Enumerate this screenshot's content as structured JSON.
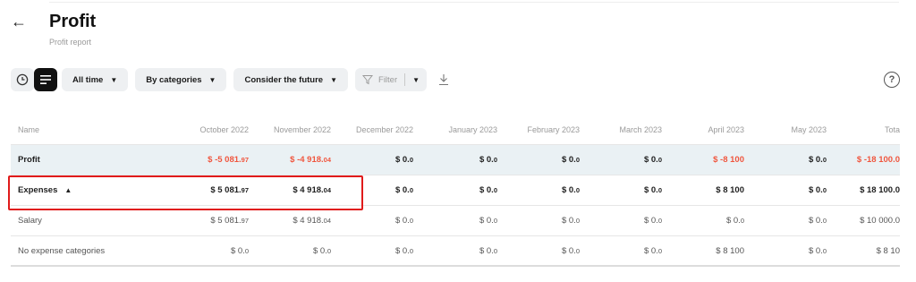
{
  "header": {
    "back_icon": "arrow-left-icon",
    "title": "Profit",
    "subtitle": "Profit report"
  },
  "toolbar": {
    "clock_icon": "clock-icon",
    "list_icon": "list-icon",
    "period": "All time",
    "grouping": "By categories",
    "future": "Consider the future",
    "filter_placeholder": "Filter",
    "download_icon": "download-icon",
    "help_icon": "help-icon"
  },
  "table": {
    "columns": [
      "Name",
      "October 2022",
      "November 2022",
      "December 2022",
      "January 2023",
      "February 2023",
      "March 2023",
      "April 2023",
      "May 2023",
      "Tota"
    ],
    "rows": [
      {
        "name": "Profit",
        "cells": [
          {
            "main": "$ -5 081.",
            "cents": "97",
            "tone": "neg"
          },
          {
            "main": "$ -4 918.",
            "cents": "04",
            "tone": "neg"
          },
          {
            "main": "$ 0.",
            "cents": "0",
            "tone": "pos"
          },
          {
            "main": "$ 0.",
            "cents": "0",
            "tone": "pos"
          },
          {
            "main": "$ 0.",
            "cents": "0",
            "tone": "pos"
          },
          {
            "main": "$ 0.",
            "cents": "0",
            "tone": "pos"
          },
          {
            "main": "$ -8 100",
            "cents": "",
            "tone": "neg"
          },
          {
            "main": "$ 0.",
            "cents": "0",
            "tone": "pos"
          },
          {
            "main": "$ -18 100.0",
            "cents": "",
            "tone": "neg"
          }
        ]
      },
      {
        "name": "Expenses",
        "cells": [
          {
            "main": "$ 5 081.",
            "cents": "97"
          },
          {
            "main": "$ 4 918.",
            "cents": "04"
          },
          {
            "main": "$ 0.",
            "cents": "0"
          },
          {
            "main": "$ 0.",
            "cents": "0"
          },
          {
            "main": "$ 0.",
            "cents": "0"
          },
          {
            "main": "$ 0.",
            "cents": "0"
          },
          {
            "main": "$ 8 100",
            "cents": ""
          },
          {
            "main": "$ 0.",
            "cents": "0"
          },
          {
            "main": "$ 18 100.0",
            "cents": ""
          }
        ]
      },
      {
        "name": "Salary",
        "cells": [
          {
            "main": "$ 5 081.",
            "cents": "97"
          },
          {
            "main": "$ 4 918.",
            "cents": "04"
          },
          {
            "main": "$ 0.",
            "cents": "0"
          },
          {
            "main": "$ 0.",
            "cents": "0"
          },
          {
            "main": "$ 0.",
            "cents": "0"
          },
          {
            "main": "$ 0.",
            "cents": "0"
          },
          {
            "main": "$ 0.",
            "cents": "0"
          },
          {
            "main": "$ 0.",
            "cents": "0"
          },
          {
            "main": "$ 10 000.0",
            "cents": ""
          }
        ]
      },
      {
        "name": "No expense categories",
        "cells": [
          {
            "main": "$ 0.",
            "cents": "0"
          },
          {
            "main": "$ 0.",
            "cents": "0"
          },
          {
            "main": "$ 0.",
            "cents": "0"
          },
          {
            "main": "$ 0.",
            "cents": "0"
          },
          {
            "main": "$ 0.",
            "cents": "0"
          },
          {
            "main": "$ 0.",
            "cents": "0"
          },
          {
            "main": "$ 8 100",
            "cents": ""
          },
          {
            "main": "$ 0.",
            "cents": "0"
          },
          {
            "main": "$ 8 10",
            "cents": ""
          }
        ]
      }
    ]
  },
  "colors": {
    "negative": "#f0563e",
    "profit_row_bg": "#eaf1f4",
    "highlight_border": "#e01b1b",
    "active_toggle_bg": "#111111"
  }
}
